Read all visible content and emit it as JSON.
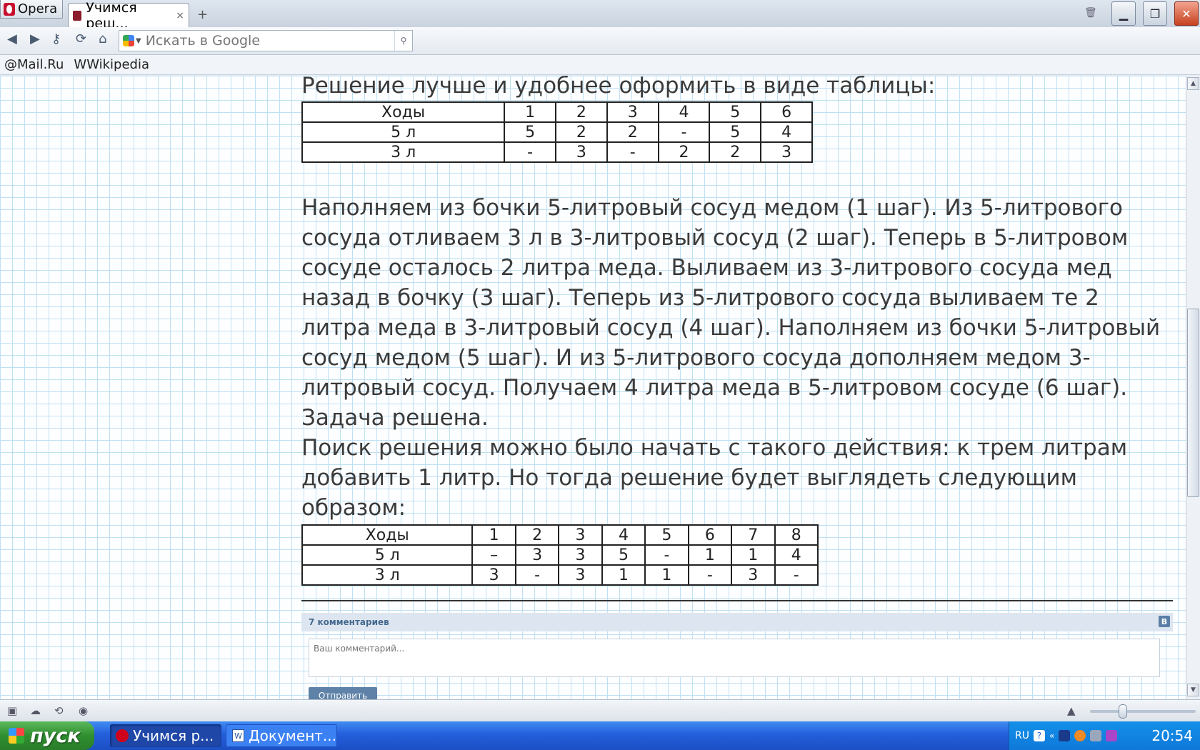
{
  "browser": {
    "menu_label": "Opera",
    "tab_title": "Учимся реш...",
    "tab_close": "×",
    "new_tab": "+",
    "search_placeholder": "Искать в Google"
  },
  "bookmarks": [
    {
      "label": "@Mail.Ru"
    },
    {
      "label": "WWikipedia"
    }
  ],
  "article": {
    "intro": "Решение лучше и удобнее оформить в виде таблицы:",
    "table1": {
      "header": [
        "Ходы",
        "1",
        "2",
        "3",
        "4",
        "5",
        "6"
      ],
      "rows": [
        [
          "5 л",
          "5",
          "2",
          "2",
          "-",
          "5",
          "4"
        ],
        [
          "3 л",
          "-",
          "3",
          "-",
          "2",
          "2",
          "3"
        ]
      ]
    },
    "paragraph1": "Наполняем из бочки 5-литровый сосуд медом (1 шаг). Из 5-литрового сосуда отливаем 3 л в 3-литровый сосуд (2 шаг). Теперь в 5-литровом сосуде осталось 2 литра меда. Выливаем из 3-литрового сосуда мед назад в бочку (3 шаг). Теперь из 5-литрового сосуда выливаем те 2 литра меда в 3-литровый сосуд (4 шаг). Наполняем из бочки 5-литровый сосуд медом (5 шаг). И из 5-литрового сосуда дополняем медом 3-литровый сосуд. Получаем 4 литра меда в 5-литровом сосуде (6 шаг). Задача решена.",
    "paragraph2": "Поиск решения можно было начать с такого действия: к трем литрам добавить 1 литр. Но тогда решение будет выглядеть следующим образом:",
    "table2": {
      "header": [
        "Ходы",
        "1",
        "2",
        "3",
        "4",
        "5",
        "6",
        "7",
        "8"
      ],
      "rows": [
        [
          "5 л",
          "–",
          "3",
          "3",
          "5",
          "-",
          "1",
          "1",
          "4"
        ],
        [
          "3 л",
          "3",
          "-",
          "3",
          "1",
          "1",
          "-",
          "3",
          "-"
        ]
      ]
    }
  },
  "comments": {
    "count_label": "7 комментариев",
    "vk_badge": "В",
    "input_placeholder": "Ваш комментарий...",
    "send_label": "Отправить"
  },
  "taskbar": {
    "start_label": "пуск",
    "tasks": [
      {
        "label": "Учимся р...",
        "active": true
      },
      {
        "label": "Документ...",
        "active": false
      }
    ],
    "lang": "RU",
    "clock": "20:54"
  }
}
